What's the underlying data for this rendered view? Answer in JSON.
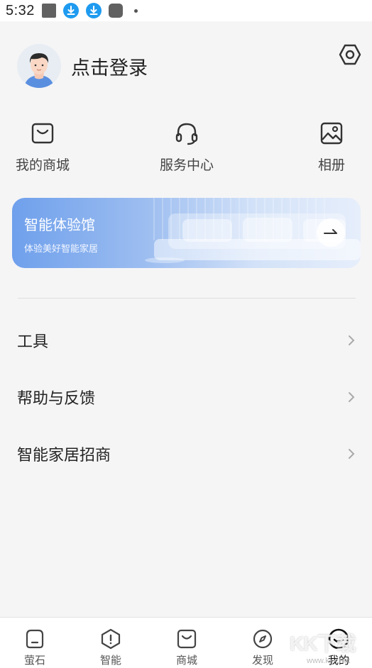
{
  "status_bar": {
    "time": "5:32"
  },
  "profile": {
    "login_label": "点击登录"
  },
  "quick_actions": [
    {
      "label": "我的商城",
      "icon": "shopping-bag-icon"
    },
    {
      "label": "服务中心",
      "icon": "headset-icon"
    },
    {
      "label": "相册",
      "icon": "photo-album-icon"
    }
  ],
  "banner": {
    "title": "智能体验馆",
    "subtitle": "体验美好智能家居",
    "arrow": "→"
  },
  "menu": [
    {
      "label": "工具"
    },
    {
      "label": "帮助与反馈"
    },
    {
      "label": "智能家居招商"
    }
  ],
  "tabs": [
    {
      "label": "萤石",
      "icon": "home-device-icon"
    },
    {
      "label": "智能",
      "icon": "smart-shield-icon"
    },
    {
      "label": "商城",
      "icon": "shopping-bag-icon"
    },
    {
      "label": "发现",
      "icon": "compass-icon"
    },
    {
      "label": "我的",
      "icon": "smiley-icon",
      "active": true
    }
  ],
  "watermark": {
    "text": "KK下载",
    "url": "www.kkx.net"
  },
  "colors": {
    "accent_blue": "#1e9bf0",
    "banner_start": "#6fa0ec",
    "background": "#f5f5f6"
  }
}
